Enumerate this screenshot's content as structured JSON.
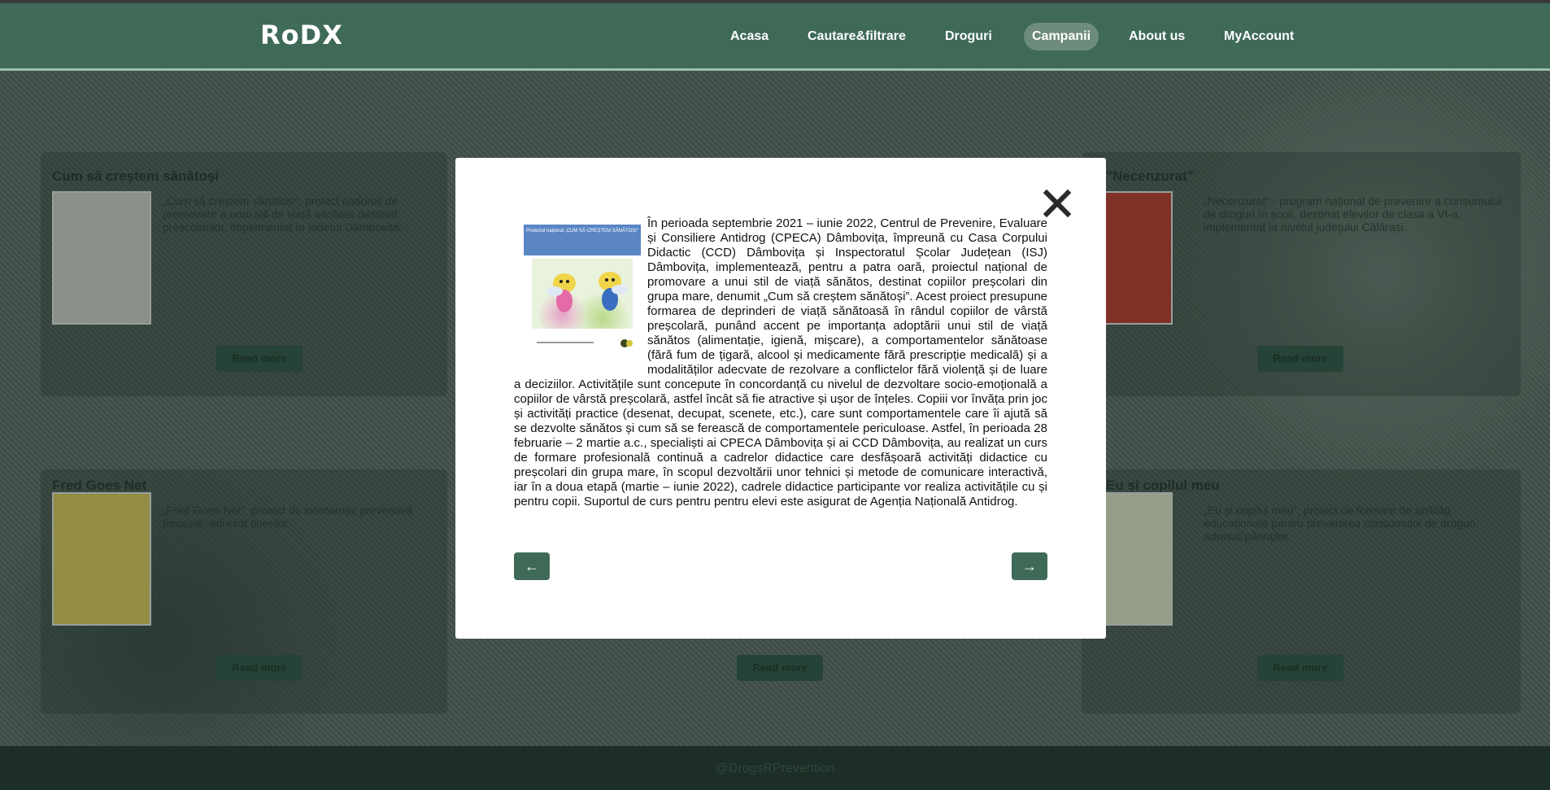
{
  "header": {
    "logo": "RoDX",
    "nav": [
      {
        "label": "Acasa"
      },
      {
        "label": "Cautare&filtrare"
      },
      {
        "label": "Droguri"
      },
      {
        "label": "Campanii",
        "active": true
      },
      {
        "label": "About us"
      },
      {
        "label": "MyAccount"
      }
    ]
  },
  "background": {
    "cards": [
      {
        "title": "Cum să creștem sănătoși",
        "text": "„Cum să creștem sănătoși”, proiect național de promovare a unui stil de viață sănătos destinat preșcolarilor, implementat în județul Dâmbovița.",
        "button": "Read more"
      },
      {
        "title": "\"Necenzurat\"",
        "text": "„Necenzurat” - program național de prevenire a consumului de droguri în școli, destinat elevilor de clasa a VI-a, implementat la nivelul județului Călărași.",
        "button": "Read more"
      },
      {
        "title": "Fred Goes Net",
        "text": "„Fred Goes Net”, proiect de intervenție preventivă timpurie, adresat tinerilor.",
        "button": "Read more"
      },
      {
        "title": "",
        "text": "",
        "button": "Read more"
      },
      {
        "title": "Eu și copilul meu",
        "text": "„Eu și copilul meu”, proiect de formare de abilități educaționale pentru prevenirea consumului de droguri, adresat părinților.",
        "button": "Read more"
      }
    ],
    "footer": "@DrogsRPrevention"
  },
  "modal": {
    "close_label": "×",
    "poster_title": "Proiectul național „CUM SĂ CREȘTEM SĂNĂTOȘI”",
    "text": "În perioada septembrie 2021 – iunie 2022, Centrul de Prevenire, Evaluare și Consiliere Antidrog (CPECA) Dâmbovița, împreună cu Casa Corpului Didactic (CCD) Dâmbovița și Inspectoratul Școlar Județean (ISJ) Dâmbovița, implementează, pentru a patra oară, proiectul național de promovare a unui stil de viață sănătos, destinat copiilor preșcolari din grupa mare, denumit „Cum să creștem sănătoși”. Acest proiect presupune formarea de deprinderi de viață sănătoasă în rândul copiilor de vârstă preșcolară, punând accent pe importanța adoptării unui stil de viață sănătos (alimentație, igienă, mișcare), a comportamentelor sănătoase (fără fum de țigară, alcool și medicamente fără prescripție medicală) și a modalităților adecvate de rezolvare a conflictelor fără violență și de luare a deciziilor. Activitățile sunt concepute în concordanță cu nivelul de dezvoltare socio-emoțională a copiilor de vârstă preșcolară, astfel încât să fie atractive și ușor de înțeles. Copiii vor învăța prin joc și activități practice (desenat, decupat, scenete, etc.), care sunt comportamentele care îi ajută să se dezvolte sănătos și cum să se ferească de comportamentele periculoase. Astfel, în perioada 28 februarie – 2 martie a.c., specialiști ai CPECA Dâmbovița și ai CCD Dâmbovița, au realizat un curs de formare profesională continuă a cadrelor didactice care desfășoară activități didactice cu preșcolari din grupa mare, în scopul dezvoltării unor tehnici și metode de comunicare interactivă, iar în a doua etapă (martie – iunie 2022), cadrele didactice participante vor realiza activitățile cu și pentru copii. Suportul de curs pentru pentru elevi este asigurat de Agenția Națională Antidrog.",
    "prev_label": "←",
    "next_label": "→"
  },
  "colors": {
    "header": "#3f6a58",
    "accent_button": "#3f6a58",
    "active_nav": "#6e8c7c"
  }
}
